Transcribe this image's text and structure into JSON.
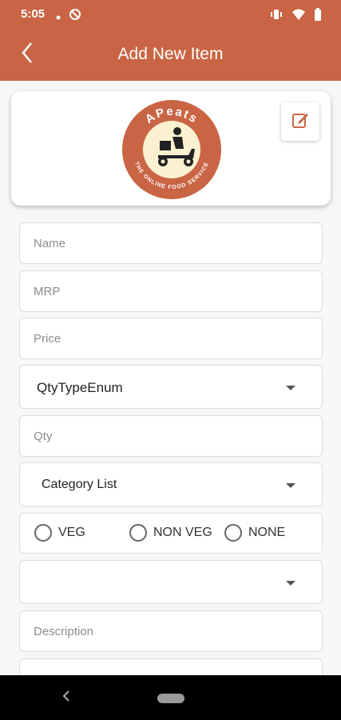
{
  "status_bar": {
    "time": "5:05",
    "icons": [
      "dot-icon",
      "data-saver-icon",
      "vibrate-icon",
      "wifi-icon",
      "battery-icon"
    ]
  },
  "app_bar": {
    "title": "Add New Item",
    "back_icon": "chevron-left-icon"
  },
  "logo": {
    "brand": "APeats",
    "tagline": "THE ONLINE FOOD SERVICE",
    "colors": {
      "ring": "#c96544",
      "inner": "#fbf1d0",
      "text": "#ffffff"
    }
  },
  "edit_icon": "edit-icon",
  "form": {
    "name_placeholder": "Name",
    "mrp_placeholder": "MRP",
    "price_placeholder": "Price",
    "qty_type_value": "QtyTypeEnum",
    "qty_placeholder": "Qty",
    "category_value": "Category List",
    "food_type_options": [
      "VEG",
      "NON VEG",
      "NONE"
    ],
    "third_dropdown_value": "",
    "description_placeholder": "Description"
  },
  "colors": {
    "primary": "#c96544",
    "background": "#f7f7f7"
  }
}
